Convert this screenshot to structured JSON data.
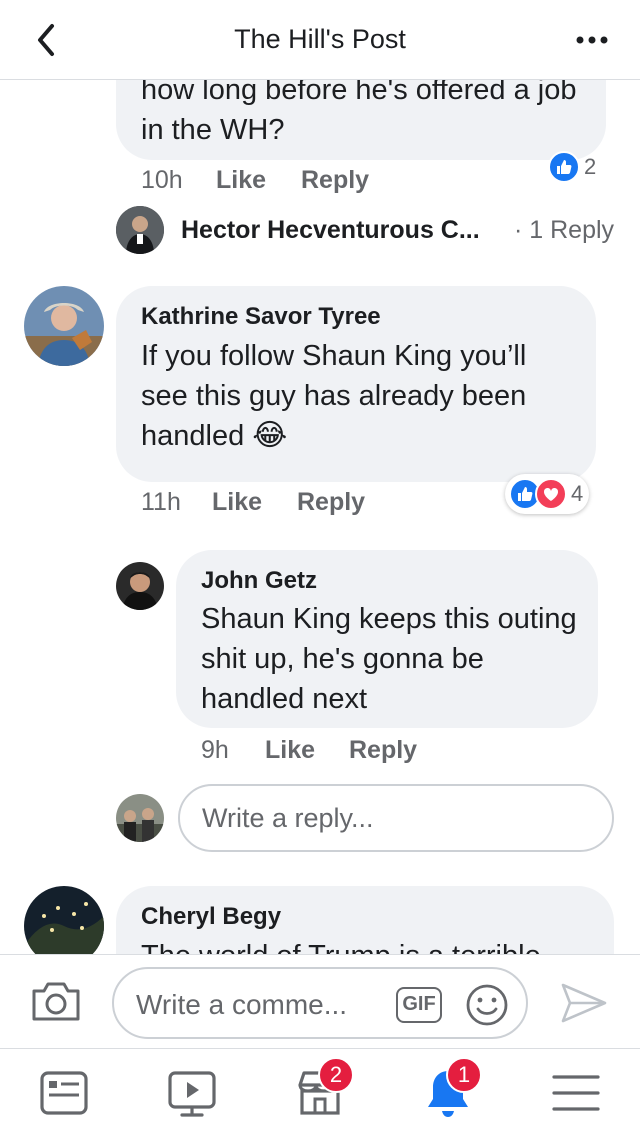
{
  "header": {
    "title": "The Hill's Post"
  },
  "comments": {
    "c1": {
      "text": "how long before he's offered a job in the WH?",
      "time": "10h",
      "like_label": "Like",
      "reply_label": "Reply",
      "reaction_count": "2"
    },
    "c1_reply_preview": {
      "name": "Hector Hecventurous C...",
      "replies": "· 1 Reply"
    },
    "c2": {
      "author": "Kathrine Savor Tyree",
      "text": "If you follow Shaun King you’ll see this guy has already been handled",
      "emoji": "😂",
      "time": "11h",
      "like_label": "Like",
      "reply_label": "Reply",
      "reaction_count": "4"
    },
    "c2_reply": {
      "author": "John Getz",
      "text": "Shaun King keeps this outing shit up, he's gonna be handled next",
      "time": "9h",
      "like_label": "Like",
      "reply_label": "Reply"
    },
    "reply_input": {
      "placeholder": "Write a reply..."
    },
    "c3": {
      "author": "Cheryl Begy",
      "text": "The world of Trump is a terrible"
    }
  },
  "composer": {
    "placeholder": "Write a comme...",
    "gif_label": "GIF"
  },
  "tabbar": {
    "marketplace_badge": "2",
    "notifications_badge": "1"
  },
  "colors": {
    "accent": "#1877f2",
    "love": "#f33e58",
    "badge": "#e41e3f",
    "bubble": "#f0f2f5",
    "secondary_text": "#65676b"
  },
  "icons": [
    "back-arrow-icon",
    "more-dots-icon",
    "like-reaction-icon",
    "love-reaction-icon",
    "camera-icon",
    "emoji-icon",
    "send-icon",
    "news-feed-icon",
    "watch-icon",
    "marketplace-icon",
    "notifications-bell-icon",
    "menu-icon"
  ]
}
